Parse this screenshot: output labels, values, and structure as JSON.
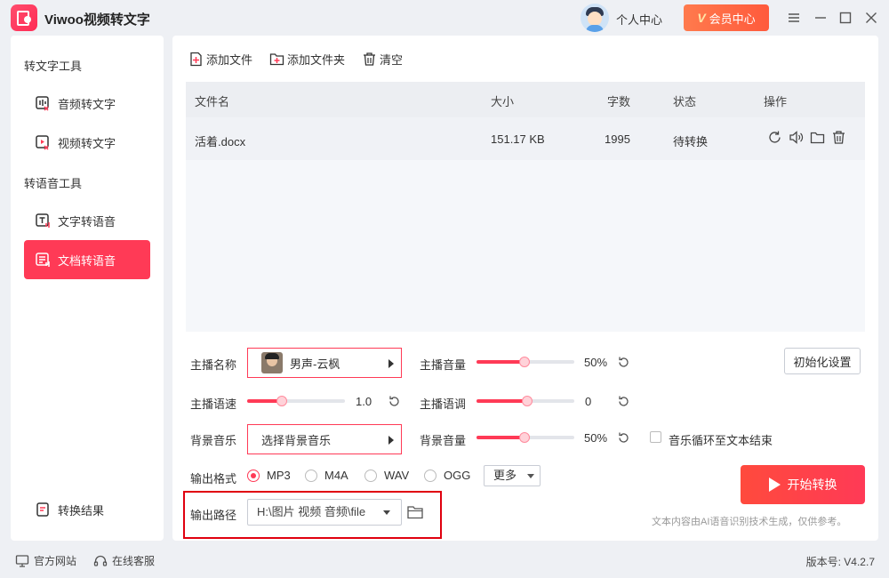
{
  "app": {
    "title": "Viwoo视频转文字"
  },
  "header": {
    "user_center": "个人中心",
    "vip_label": "会员中心",
    "vip_badge": "V"
  },
  "sidebar": {
    "section_text": "转文字工具",
    "section_voice": "转语音工具",
    "items": [
      {
        "label": "音频转文字",
        "icon": "audio-text-icon"
      },
      {
        "label": "视频转文字",
        "icon": "video-text-icon"
      },
      {
        "label": "文字转语音",
        "icon": "text-speech-icon"
      },
      {
        "label": "文档转语音",
        "icon": "doc-speech-icon",
        "active": true
      }
    ],
    "results": "转换结果"
  },
  "toolbar": {
    "add_file": "添加文件",
    "add_folder": "添加文件夹",
    "clear": "清空"
  },
  "table": {
    "columns": [
      "文件名",
      "大小",
      "字数",
      "状态",
      "操作"
    ],
    "rows": [
      {
        "name": "活着.docx",
        "size": "151.17 KB",
        "words": "1995",
        "status": "待转换"
      }
    ]
  },
  "settings": {
    "anchor_name_label": "主播名称",
    "anchor_voice": "男声-云枫",
    "anchor_volume_label": "主播音量",
    "anchor_volume": "50%",
    "anchor_volume_level": 0.5,
    "init_button": "初始化设置",
    "anchor_speed_label": "主播语速",
    "anchor_speed": "1.0",
    "anchor_tone_label": "主播语调",
    "anchor_tone": "0",
    "bgm_label": "背景音乐",
    "bgm_select": "选择背景音乐",
    "bgm_volume_label": "背景音量",
    "bgm_volume": "50%",
    "loop_label": "音乐循环至文本结束",
    "format_label": "输出格式",
    "formats": [
      "MP3",
      "M4A",
      "WAV",
      "OGG"
    ],
    "selected_format": "MP3",
    "more": "更多",
    "path_label": "输出路径",
    "path_value": "H:\\图片 视频 音频\\file",
    "start_button": "开始转换",
    "disclaimer": "文本内容由AI语音识别技术生成，仅供参考。"
  },
  "footer": {
    "website": "官方网站",
    "service": "在线客服",
    "version": "版本号: V4.2.7"
  },
  "colors": {
    "accent": "#ff3a56",
    "highlight": "#e0000f",
    "vip": "#ff6a42"
  }
}
